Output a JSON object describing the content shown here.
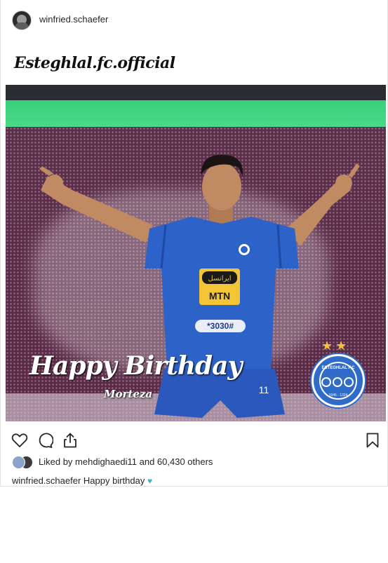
{
  "post": {
    "author": "winfried.schaefer",
    "image": {
      "brand_text": "Esteghlal.fc.official",
      "headline": "Happy Birthday",
      "name": "Morteza",
      "jersey": {
        "sponsor": "MTN",
        "brand_fa": "ایرانسل",
        "code": "*3030#",
        "number": "11"
      },
      "crest_text": "ESTEGHLAL F.C",
      "crest_year": "1945 - 1324"
    },
    "likes": {
      "prefix": "Liked by ",
      "user": "mehdighaedi11",
      "suffix": " and 60,430 others"
    },
    "caption": {
      "user": "winfried.schaefer",
      "text": " Happy birthday"
    }
  },
  "icons": {
    "like": "heart-icon",
    "comment": "comment-icon",
    "share": "share-icon",
    "save": "bookmark-icon"
  },
  "colors": {
    "accent_heart": "#3ab8c9",
    "club_blue": "#2f6bc7"
  }
}
